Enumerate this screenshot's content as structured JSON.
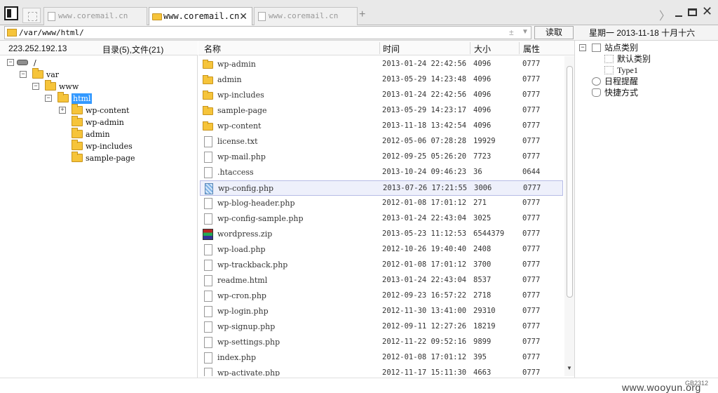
{
  "tabs": [
    {
      "label": "www.coremail.cn",
      "active": false
    },
    {
      "label": "www.coremail.cn",
      "active": true
    },
    {
      "label": "www.coremail.cn",
      "active": false
    }
  ],
  "address": {
    "path": "/var/www/html/",
    "read_label": "读取"
  },
  "date_text": "星期一  2013-11-18  十月十六",
  "left": {
    "ip": "223.252.192.13",
    "counts": "目录(5),文件(21)",
    "tree": [
      {
        "label": "/",
        "expander": "⊟",
        "icon": "drive"
      },
      {
        "label": "var",
        "expander": "⊟",
        "icon": "folder"
      },
      {
        "label": "www",
        "expander": "⊟",
        "icon": "folder"
      },
      {
        "label": "html",
        "expander": "⊟",
        "icon": "folder-open",
        "selected": true
      },
      {
        "label": "wp-content",
        "expander": "⊞",
        "icon": "folder"
      },
      {
        "label": "wp-admin",
        "expander": "",
        "icon": "folder"
      },
      {
        "label": "admin",
        "expander": "",
        "icon": "folder"
      },
      {
        "label": "wp-includes",
        "expander": "",
        "icon": "folder"
      },
      {
        "label": "sample-page",
        "expander": "",
        "icon": "folder"
      }
    ]
  },
  "list": {
    "columns": {
      "name": "名称",
      "time": "时间",
      "size": "大小",
      "attr": "属性"
    },
    "rows": [
      {
        "name": "wp-admin",
        "time": "2013-01-24 22:42:56",
        "size": "4096",
        "attr": "0777",
        "type": "folder"
      },
      {
        "name": "admin",
        "time": "2013-05-29 14:23:48",
        "size": "4096",
        "attr": "0777",
        "type": "folder"
      },
      {
        "name": "wp-includes",
        "time": "2013-01-24 22:42:56",
        "size": "4096",
        "attr": "0777",
        "type": "folder"
      },
      {
        "name": "sample-page",
        "time": "2013-05-29 14:23:17",
        "size": "4096",
        "attr": "0777",
        "type": "folder"
      },
      {
        "name": "wp-content",
        "time": "2013-11-18 13:42:54",
        "size": "4096",
        "attr": "0777",
        "type": "folder"
      },
      {
        "name": "license.txt",
        "time": "2012-05-06 07:28:28",
        "size": "19929",
        "attr": "0777",
        "type": "file"
      },
      {
        "name": "wp-mail.php",
        "time": "2012-09-25 05:26:20",
        "size": "7723",
        "attr": "0777",
        "type": "file"
      },
      {
        "name": ".htaccess",
        "time": "2013-10-24 09:46:23",
        "size": "36",
        "attr": "0644",
        "type": "file"
      },
      {
        "name": "wp-config.php",
        "time": "2013-07-26 17:21:55",
        "size": "3006",
        "attr": "0777",
        "type": "config",
        "selected": true
      },
      {
        "name": "wp-blog-header.php",
        "time": "2012-01-08 17:01:12",
        "size": "271",
        "attr": "0777",
        "type": "file"
      },
      {
        "name": "wp-config-sample.php",
        "time": "2013-01-24 22:43:04",
        "size": "3025",
        "attr": "0777",
        "type": "file"
      },
      {
        "name": "wordpress.zip",
        "time": "2013-05-23 11:12:53",
        "size": "6544379",
        "attr": "0777",
        "type": "zip"
      },
      {
        "name": "wp-load.php",
        "time": "2012-10-26 19:40:40",
        "size": "2408",
        "attr": "0777",
        "type": "file"
      },
      {
        "name": "wp-trackback.php",
        "time": "2012-01-08 17:01:12",
        "size": "3700",
        "attr": "0777",
        "type": "file"
      },
      {
        "name": "readme.html",
        "time": "2013-01-24 22:43:04",
        "size": "8537",
        "attr": "0777",
        "type": "file"
      },
      {
        "name": "wp-cron.php",
        "time": "2012-09-23 16:57:22",
        "size": "2718",
        "attr": "0777",
        "type": "file"
      },
      {
        "name": "wp-login.php",
        "time": "2012-11-30 13:41:00",
        "size": "29310",
        "attr": "0777",
        "type": "file"
      },
      {
        "name": "wp-signup.php",
        "time": "2012-09-11 12:27:26",
        "size": "18219",
        "attr": "0777",
        "type": "file"
      },
      {
        "name": "wp-settings.php",
        "time": "2012-11-22 09:52:16",
        "size": "9899",
        "attr": "0777",
        "type": "file"
      },
      {
        "name": "index.php",
        "time": "2012-01-08 17:01:12",
        "size": "395",
        "attr": "0777",
        "type": "file"
      },
      {
        "name": "wp-activate.php",
        "time": "2012-11-17 15:11:30",
        "size": "4663",
        "attr": "0777",
        "type": "file"
      }
    ]
  },
  "right": {
    "items": [
      {
        "label": "站点类别",
        "expander": "⊟"
      },
      {
        "label": "默认类别",
        "expander": ""
      },
      {
        "label": "Type1",
        "expander": ""
      },
      {
        "label": "日程提醒",
        "expander": ""
      },
      {
        "label": "快捷方式",
        "expander": ""
      }
    ]
  },
  "status": {
    "encoding": "GB2312",
    "watermark": "www.wooyun.org"
  },
  "colors": {
    "folder": "#f6c43a",
    "selection": "#3399ff",
    "row_selected": "#eef0fb"
  }
}
